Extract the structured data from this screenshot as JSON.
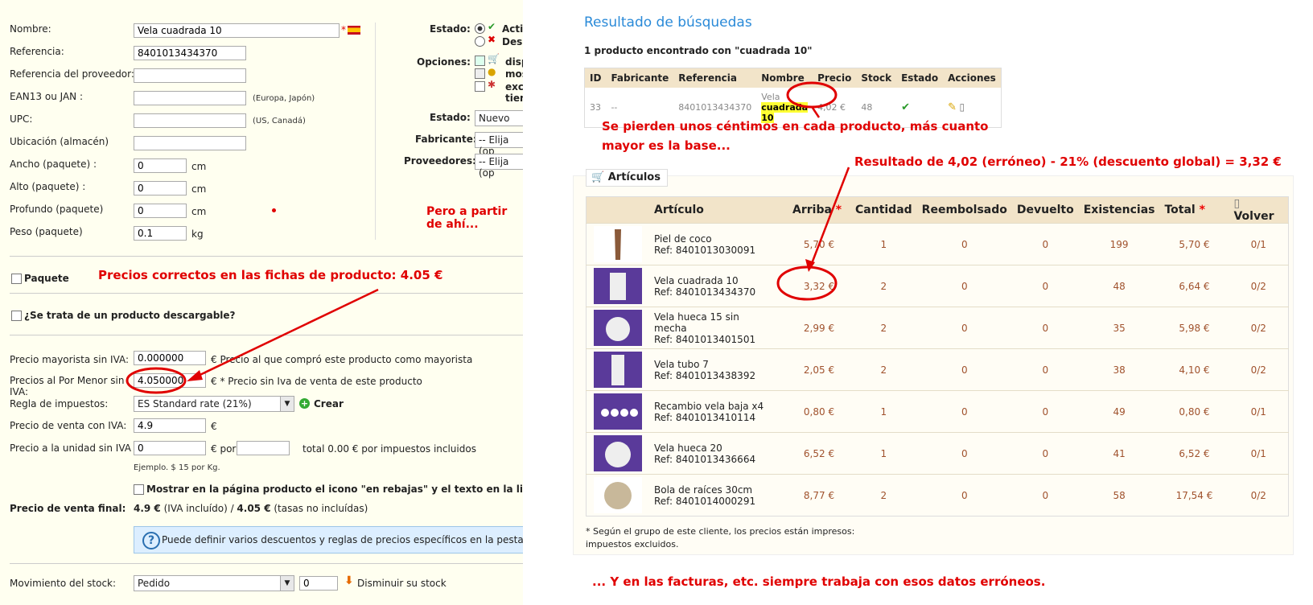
{
  "product_form": {
    "nombre_label": "Nombre:",
    "nombre_value": "Vela cuadrada 10",
    "referencia_label": "Referencia:",
    "referencia_value": "8401013434370",
    "ref_proveedor_label": "Referencia del proveedor:",
    "ean_label": "EAN13 ou JAN :",
    "ean_hint": "(Europa, Japón)",
    "upc_label": "UPC:",
    "upc_hint": "(US, Canadá)",
    "ubicacion_label": "Ubicación (almacén)",
    "ancho_label": "Ancho (paquete) :",
    "ancho_value": "0",
    "ancho_unit": "cm",
    "alto_label": "Alto (paquete) :",
    "alto_value": "0",
    "alto_unit": "cm",
    "profundo_label": "Profundo (paquete)",
    "profundo_value": "0",
    "profundo_unit": "cm",
    "peso_label": "Peso (paquete)",
    "peso_value": "0.1",
    "peso_unit": "kg",
    "estado_label": "Estado:",
    "estado_opt1": "Acti",
    "estado_opt2": "Des",
    "opciones_label": "Opciones:",
    "opc1": "disp",
    "opc2": "mos",
    "opc3": "exc",
    "opc3b": "tien",
    "estado2_label": "Estado:",
    "estado2_value": "Nuevo",
    "fabricante_label": "Fabricante:",
    "fabricante_value": "-- Elija (op",
    "proveedores_label": "Proveedores:",
    "proveedores_value": "-- Elija (op",
    "paquete_label": "Paquete",
    "descargable_label": "¿Se trata de un producto descargable?",
    "precio_mayorista_label": "Precio mayorista sin IVA:",
    "precio_mayorista_value": "0.000000",
    "precio_mayorista_hint": "€ Precio al que compró este producto como mayorista",
    "precio_menor_label_1": "Precios al Por Menor sin",
    "precio_menor_label_2": "IVA:",
    "precio_menor_value": "4.050000",
    "precio_menor_hint": "€ * Precio sin Iva de venta de este producto",
    "regla_label": "Regla de impuestos:",
    "regla_value": "ES Standard rate (21%)",
    "crear_label": "Crear",
    "precio_venta_label": "Precio de venta con IVA:",
    "precio_venta_value": "4.9",
    "precio_venta_unit": "€",
    "precio_unidad_label": "Precio a la unidad sin IVA",
    "precio_unidad_value": "0",
    "precio_unidad_por": "€ por",
    "precio_unidad_total": "total 0.00 € por impuestos incluidos",
    "ejemplo": "Ejemplo. $ 15 por Kg.",
    "rebajas_label": "Mostrar en la página producto el icono \"en rebajas\" y el texto en la lista de product",
    "precio_final_label": "Precio de venta final:",
    "precio_final_value_a": "4.9 €",
    "precio_final_value_b": " (IVA incluído) / ",
    "precio_final_value_c": "4.05 €",
    "precio_final_value_d": " (tasas no incluídas)",
    "info_text": "Puede definir varios descuentos y reglas de precios específicos en la pestaña pre",
    "movimiento_label": "Movimiento del stock:",
    "movimiento_value": "Pedido",
    "movimiento_qty": "0",
    "disminuir": "Disminuir su stock"
  },
  "annotations": {
    "pero": "Pero a partir de ahí...",
    "correctos": "Precios correctos en las fichas de producto: 4.05 €",
    "pierden_1": "Se pierden unos céntimos en cada producto, más cuanto",
    "pierden_2": "mayor es la base...",
    "resultado": "Resultado de 4,02 (erróneo) - 21% (descuento global) = 3,32 €",
    "facturas": "... Y en las facturas, etc. siempre trabaja con esos datos erróneos."
  },
  "search": {
    "title": "Resultado de búsquedas",
    "subtitle": "1 producto encontrado con \"cuadrada 10\"",
    "headers": [
      "ID",
      "Fabricante",
      "Referencia",
      "Nombre",
      "Precio",
      "Stock",
      "Estado",
      "Acciones"
    ],
    "row": {
      "id": "33",
      "fabricante": "--",
      "referencia": "8401013434370",
      "nombre_pre": "Vela ",
      "nombre_hl": "cuadrada 10",
      "precio": "4,02 €",
      "stock": "48"
    }
  },
  "articulos": {
    "legend": "Artículos",
    "headers": [
      "Artículo",
      "Arriba",
      "Cantidad",
      "Reembolsado",
      "Devuelto",
      "Existencias",
      "Total",
      "Volver"
    ],
    "rows": [
      {
        "name1": "Piel de coco",
        "name2": "",
        "ref": "Ref: 8401013030091",
        "arriba": "5,70 €",
        "cantidad": "1",
        "reemb": "0",
        "devuelto": "0",
        "exist": "199",
        "total": "5,70 €",
        "volver": "0/1"
      },
      {
        "name1": "Vela cuadrada 10",
        "name2": "",
        "ref": "Ref: 8401013434370",
        "arriba": "3,32 €",
        "cantidad": "2",
        "reemb": "0",
        "devuelto": "0",
        "exist": "48",
        "total": "6,64 €",
        "volver": "0/2"
      },
      {
        "name1": "Vela hueca 15 sin",
        "name2": "mecha",
        "ref": "Ref: 8401013401501",
        "arriba": "2,99 €",
        "cantidad": "2",
        "reemb": "0",
        "devuelto": "0",
        "exist": "35",
        "total": "5,98 €",
        "volver": "0/2"
      },
      {
        "name1": "Vela tubo 7",
        "name2": "",
        "ref": "Ref: 8401013438392",
        "arriba": "2,05 €",
        "cantidad": "2",
        "reemb": "0",
        "devuelto": "0",
        "exist": "38",
        "total": "4,10 €",
        "volver": "0/2"
      },
      {
        "name1": "Recambio vela baja x4",
        "name2": "",
        "ref": "Ref: 8401013410114",
        "arriba": "0,80 €",
        "cantidad": "1",
        "reemb": "0",
        "devuelto": "0",
        "exist": "49",
        "total": "0,80 €",
        "volver": "0/1"
      },
      {
        "name1": "Vela hueca 20",
        "name2": "",
        "ref": "Ref: 8401013436664",
        "arriba": "6,52 €",
        "cantidad": "1",
        "reemb": "0",
        "devuelto": "0",
        "exist": "41",
        "total": "6,52 €",
        "volver": "0/1"
      },
      {
        "name1": "Bola de raíces 30cm",
        "name2": "",
        "ref": "Ref: 8401014000291",
        "arriba": "8,77 €",
        "cantidad": "2",
        "reemb": "0",
        "devuelto": "0",
        "exist": "58",
        "total": "17,54 €",
        "volver": "0/2"
      }
    ],
    "footnote_1": "* Según el grupo de este cliente, los precios están impresos:",
    "footnote_2": "impuestos excluidos."
  },
  "colors": {
    "accent_red": "#e00000",
    "header_bg": "#f2e4c9",
    "title_blue": "#2a8ad8"
  }
}
